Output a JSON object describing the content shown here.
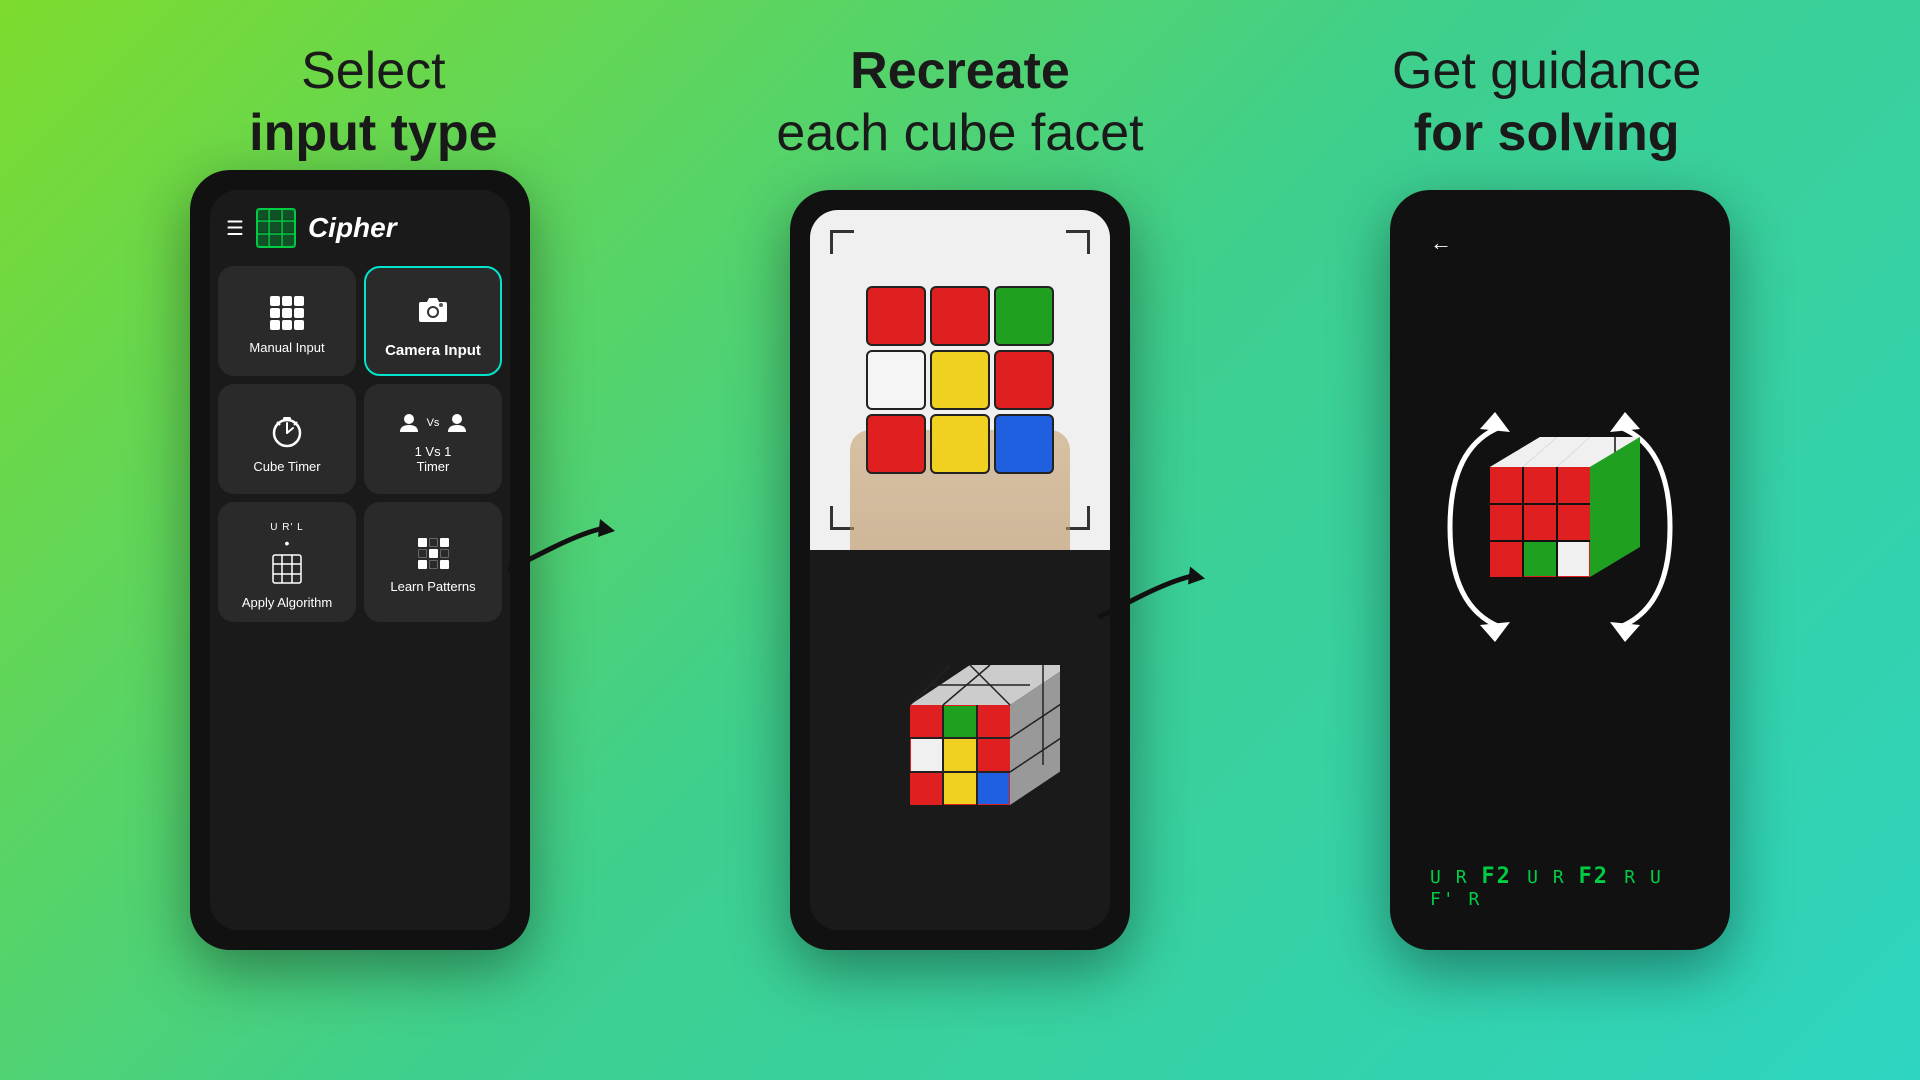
{
  "headers": [
    {
      "id": "header1",
      "line1": "Select",
      "line2_bold": "input type",
      "line2_normal": ""
    },
    {
      "id": "header2",
      "line1_bold": "Recreate",
      "line2": "each cube facet"
    },
    {
      "id": "header3",
      "line1": "Get guidance",
      "line2_bold": "for solving"
    }
  ],
  "phone1": {
    "app_name": "Cipher",
    "menu_items": [
      {
        "id": "manual",
        "label": "Manual Input",
        "selected": false
      },
      {
        "id": "camera",
        "label": "Camera Input",
        "selected": true
      },
      {
        "id": "timer",
        "label": "Cube Timer",
        "selected": false
      },
      {
        "id": "versus",
        "label": "1 Vs 1\nTimer",
        "selected": false
      },
      {
        "id": "algorithm",
        "label": "Apply Algorithm",
        "selected": false
      },
      {
        "id": "patterns",
        "label": "Learn Patterns",
        "selected": false
      }
    ]
  },
  "phone2": {
    "cube_face": [
      "red",
      "red",
      "green",
      "white",
      "yellow",
      "red",
      "red",
      "yellow",
      "blue"
    ]
  },
  "phone3": {
    "algorithm": "U R F2 U R F2 R U F' R"
  },
  "colors": {
    "background_start": "#7ddb2d",
    "background_end": "#2dd4c0",
    "accent_green": "#00e5cc",
    "text_dark": "#1a1a1a"
  }
}
